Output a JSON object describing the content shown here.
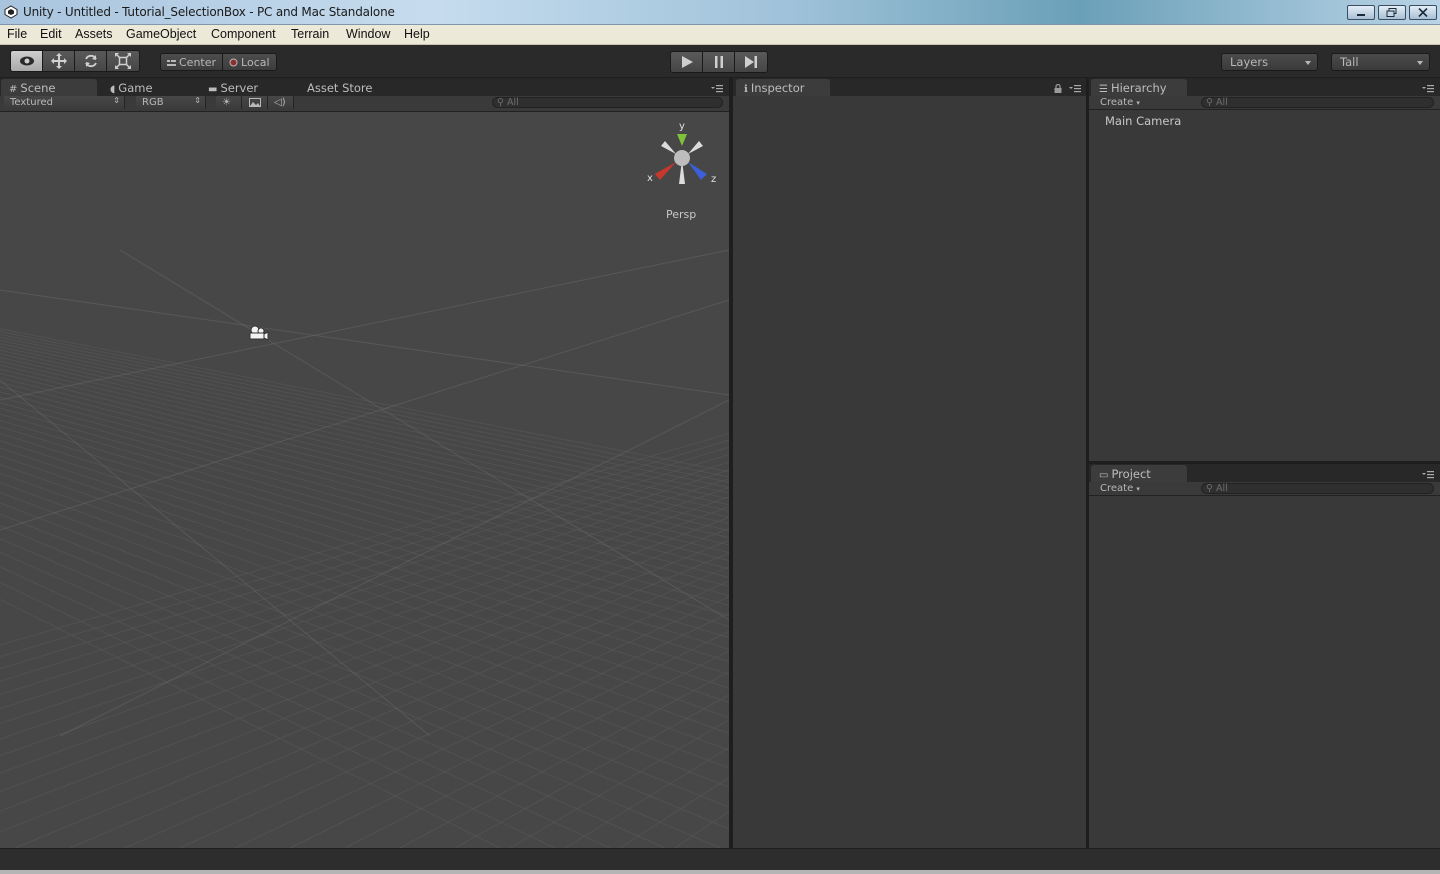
{
  "window": {
    "title": "Unity - Untitled - Tutorial_SelectionBox - PC and Mac Standalone",
    "controls": [
      "minimize",
      "maximize",
      "close"
    ]
  },
  "menu": [
    {
      "label": "File"
    },
    {
      "label": "Edit"
    },
    {
      "label": "Assets"
    },
    {
      "label": "GameObject"
    },
    {
      "label": "Component"
    },
    {
      "label": "Terrain"
    },
    {
      "label": "Window"
    },
    {
      "label": "Help"
    }
  ],
  "toolbar": {
    "transform_tools": [
      "view-tool",
      "move-tool",
      "rotate-tool",
      "scale-tool"
    ],
    "active_tool": "view-tool",
    "pivot_center": "Center",
    "pivot_local": "Local",
    "play_controls": [
      "play",
      "pause",
      "step"
    ],
    "layers_label": "Layers",
    "layout_label": "Tall"
  },
  "scene_panel": {
    "tabs": [
      {
        "label": "Scene",
        "icon": "grid-icon",
        "active": true
      },
      {
        "label": "Game",
        "icon": "pacman-icon",
        "active": false
      },
      {
        "label": "Server",
        "icon": "server-icon",
        "active": false
      },
      {
        "label": "Asset Store",
        "icon": "",
        "active": false
      }
    ],
    "render_mode": "Textured",
    "color_mode": "RGB",
    "search_placeholder": "All",
    "persp_label": "Persp",
    "gizmo_labels": {
      "y": "y",
      "x": "x",
      "z": "z"
    }
  },
  "inspector_panel": {
    "tab_label": "Inspector"
  },
  "hierarchy_panel": {
    "tab_label": "Hierarchy",
    "create_label": "Create",
    "search_placeholder": "All",
    "items": [
      "Main Camera"
    ]
  },
  "project_panel": {
    "tab_label": "Project",
    "create_label": "Create",
    "search_placeholder": "All"
  },
  "colors": {
    "gizmo_y": "#7ec23a",
    "gizmo_x": "#c8372c",
    "gizmo_z": "#3a5fd6",
    "viewport_bg": "#474747",
    "panel_bg": "#393939"
  }
}
